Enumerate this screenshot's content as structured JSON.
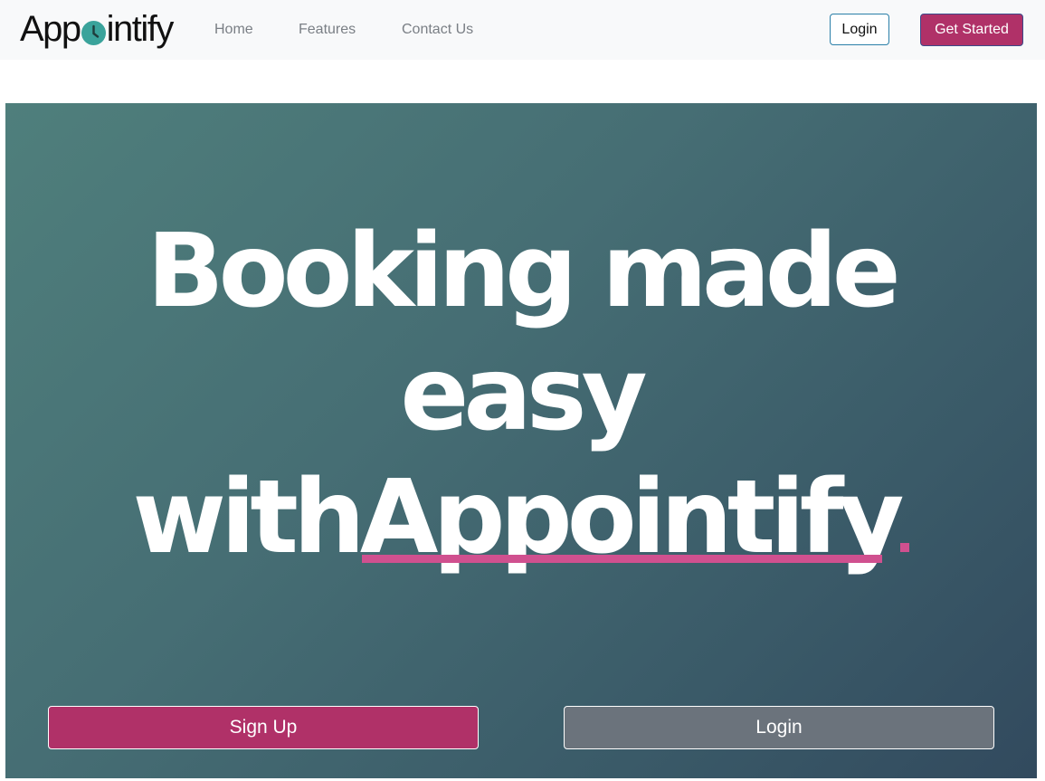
{
  "nav": {
    "brand_prefix": "App",
    "brand_suffix": "intify",
    "links": [
      "Home",
      "Features",
      "Contact Us"
    ],
    "login_label": "Login",
    "get_started_label": "Get Started"
  },
  "hero": {
    "line1": "Booking made",
    "line2": "easy",
    "line3_prefix": "with",
    "line3_brand": "Appointify"
  },
  "actions": {
    "signup_label": "Sign Up",
    "login_label": "Login"
  },
  "colors": {
    "accent": "#b03168",
    "underline": "#d0508f",
    "logo_teal": "#3aa39b",
    "secondary_button": "#6b737c"
  },
  "icons": {
    "logo_mark": "clock-icon"
  }
}
